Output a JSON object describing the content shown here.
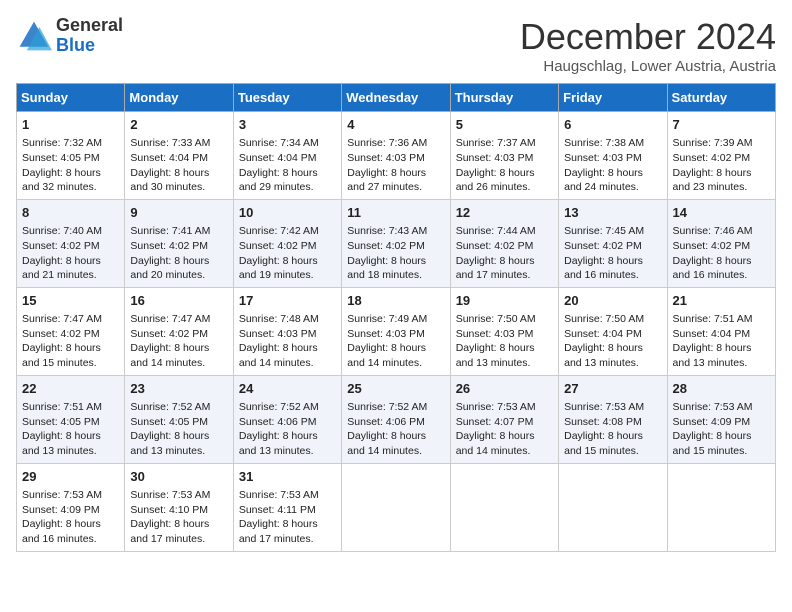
{
  "logo": {
    "general": "General",
    "blue": "Blue"
  },
  "title": "December 2024",
  "location": "Haugschlag, Lower Austria, Austria",
  "headers": [
    "Sunday",
    "Monday",
    "Tuesday",
    "Wednesday",
    "Thursday",
    "Friday",
    "Saturday"
  ],
  "weeks": [
    [
      {
        "day": "1",
        "sunrise": "7:32 AM",
        "sunset": "4:05 PM",
        "daylight": "8 hours and 32 minutes."
      },
      {
        "day": "2",
        "sunrise": "7:33 AM",
        "sunset": "4:04 PM",
        "daylight": "8 hours and 30 minutes."
      },
      {
        "day": "3",
        "sunrise": "7:34 AM",
        "sunset": "4:04 PM",
        "daylight": "8 hours and 29 minutes."
      },
      {
        "day": "4",
        "sunrise": "7:36 AM",
        "sunset": "4:03 PM",
        "daylight": "8 hours and 27 minutes."
      },
      {
        "day": "5",
        "sunrise": "7:37 AM",
        "sunset": "4:03 PM",
        "daylight": "8 hours and 26 minutes."
      },
      {
        "day": "6",
        "sunrise": "7:38 AM",
        "sunset": "4:03 PM",
        "daylight": "8 hours and 24 minutes."
      },
      {
        "day": "7",
        "sunrise": "7:39 AM",
        "sunset": "4:02 PM",
        "daylight": "8 hours and 23 minutes."
      }
    ],
    [
      {
        "day": "8",
        "sunrise": "7:40 AM",
        "sunset": "4:02 PM",
        "daylight": "8 hours and 21 minutes."
      },
      {
        "day": "9",
        "sunrise": "7:41 AM",
        "sunset": "4:02 PM",
        "daylight": "8 hours and 20 minutes."
      },
      {
        "day": "10",
        "sunrise": "7:42 AM",
        "sunset": "4:02 PM",
        "daylight": "8 hours and 19 minutes."
      },
      {
        "day": "11",
        "sunrise": "7:43 AM",
        "sunset": "4:02 PM",
        "daylight": "8 hours and 18 minutes."
      },
      {
        "day": "12",
        "sunrise": "7:44 AM",
        "sunset": "4:02 PM",
        "daylight": "8 hours and 17 minutes."
      },
      {
        "day": "13",
        "sunrise": "7:45 AM",
        "sunset": "4:02 PM",
        "daylight": "8 hours and 16 minutes."
      },
      {
        "day": "14",
        "sunrise": "7:46 AM",
        "sunset": "4:02 PM",
        "daylight": "8 hours and 16 minutes."
      }
    ],
    [
      {
        "day": "15",
        "sunrise": "7:47 AM",
        "sunset": "4:02 PM",
        "daylight": "8 hours and 15 minutes."
      },
      {
        "day": "16",
        "sunrise": "7:47 AM",
        "sunset": "4:02 PM",
        "daylight": "8 hours and 14 minutes."
      },
      {
        "day": "17",
        "sunrise": "7:48 AM",
        "sunset": "4:03 PM",
        "daylight": "8 hours and 14 minutes."
      },
      {
        "day": "18",
        "sunrise": "7:49 AM",
        "sunset": "4:03 PM",
        "daylight": "8 hours and 14 minutes."
      },
      {
        "day": "19",
        "sunrise": "7:50 AM",
        "sunset": "4:03 PM",
        "daylight": "8 hours and 13 minutes."
      },
      {
        "day": "20",
        "sunrise": "7:50 AM",
        "sunset": "4:04 PM",
        "daylight": "8 hours and 13 minutes."
      },
      {
        "day": "21",
        "sunrise": "7:51 AM",
        "sunset": "4:04 PM",
        "daylight": "8 hours and 13 minutes."
      }
    ],
    [
      {
        "day": "22",
        "sunrise": "7:51 AM",
        "sunset": "4:05 PM",
        "daylight": "8 hours and 13 minutes."
      },
      {
        "day": "23",
        "sunrise": "7:52 AM",
        "sunset": "4:05 PM",
        "daylight": "8 hours and 13 minutes."
      },
      {
        "day": "24",
        "sunrise": "7:52 AM",
        "sunset": "4:06 PM",
        "daylight": "8 hours and 13 minutes."
      },
      {
        "day": "25",
        "sunrise": "7:52 AM",
        "sunset": "4:06 PM",
        "daylight": "8 hours and 14 minutes."
      },
      {
        "day": "26",
        "sunrise": "7:53 AM",
        "sunset": "4:07 PM",
        "daylight": "8 hours and 14 minutes."
      },
      {
        "day": "27",
        "sunrise": "7:53 AM",
        "sunset": "4:08 PM",
        "daylight": "8 hours and 15 minutes."
      },
      {
        "day": "28",
        "sunrise": "7:53 AM",
        "sunset": "4:09 PM",
        "daylight": "8 hours and 15 minutes."
      }
    ],
    [
      {
        "day": "29",
        "sunrise": "7:53 AM",
        "sunset": "4:09 PM",
        "daylight": "8 hours and 16 minutes."
      },
      {
        "day": "30",
        "sunrise": "7:53 AM",
        "sunset": "4:10 PM",
        "daylight": "8 hours and 17 minutes."
      },
      {
        "day": "31",
        "sunrise": "7:53 AM",
        "sunset": "4:11 PM",
        "daylight": "8 hours and 17 minutes."
      },
      null,
      null,
      null,
      null
    ]
  ]
}
